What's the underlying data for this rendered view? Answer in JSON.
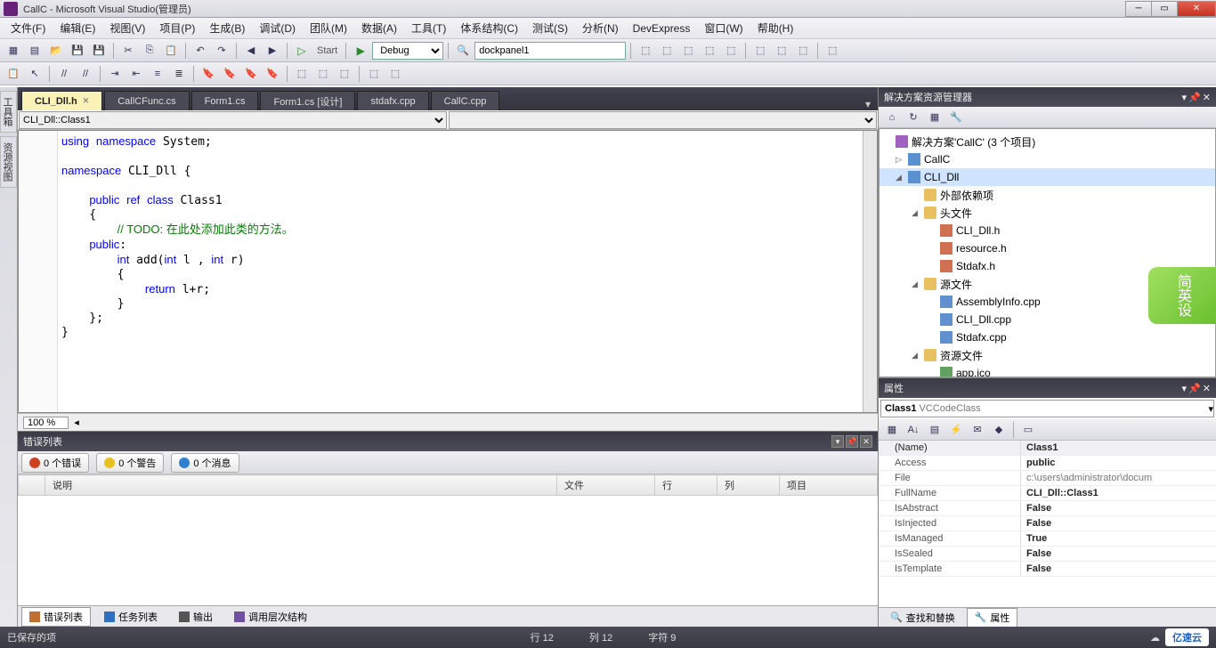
{
  "window": {
    "title": "CallC - Microsoft Visual Studio(管理员)"
  },
  "menu": [
    "文件(F)",
    "编辑(E)",
    "视图(V)",
    "项目(P)",
    "生成(B)",
    "调试(D)",
    "团队(M)",
    "数据(A)",
    "工具(T)",
    "体系结构(C)",
    "测试(S)",
    "分析(N)",
    "DevExpress",
    "窗口(W)",
    "帮助(H)"
  ],
  "toolbar1": {
    "start": "Start",
    "config": "Debug",
    "find": "dockpanel1"
  },
  "tabs": [
    {
      "label": "CLI_Dll.h",
      "active": true
    },
    {
      "label": "CallCFunc.cs"
    },
    {
      "label": "Form1.cs"
    },
    {
      "label": "Form1.cs [设计]"
    },
    {
      "label": "stdafx.cpp"
    },
    {
      "label": "CallC.cpp"
    }
  ],
  "navbar": {
    "scope": "CLI_Dll::Class1",
    "member": ""
  },
  "code": {
    "l1": "using namespace System;",
    "l2": "namespace CLI_Dll {",
    "l3": "    public ref class Class1",
    "l4": "    {",
    "l5": "        // TODO: 在此处添加此类的方法。",
    "l6": "    public:",
    "l7": "        int add(int l , int r)",
    "l8": "        {",
    "l9": "            return l+r;",
    "l10": "        }",
    "l11": "    };",
    "l12": "}"
  },
  "zoom": "100 %",
  "errorList": {
    "title": "错误列表",
    "errors": "0 个错误",
    "warnings": "0 个警告",
    "messages": "0 个消息",
    "cols": {
      "desc": "说明",
      "file": "文件",
      "line": "行",
      "col": "列",
      "proj": "项目"
    }
  },
  "bottomTabs": {
    "t1": "错误列表",
    "t2": "任务列表",
    "t3": "输出",
    "t4": "调用层次结构"
  },
  "solution": {
    "title": "解决方案资源管理器",
    "root": "解决方案'CallC' (3 个项目)",
    "items": [
      "CallC",
      "CLI_Dll",
      "外部依赖项",
      "头文件",
      "CLI_Dll.h",
      "resource.h",
      "Stdafx.h",
      "源文件",
      "AssemblyInfo.cpp",
      "CLI_Dll.cpp",
      "Stdafx.cpp",
      "资源文件",
      "app.ico"
    ]
  },
  "props": {
    "title": "属性",
    "selector": "Class1 VCCodeClass",
    "rows": [
      {
        "k": "(Name)",
        "v": "Class1"
      },
      {
        "k": "Access",
        "v": "public"
      },
      {
        "k": "File",
        "v": "c:\\users\\administrator\\docum"
      },
      {
        "k": "FullName",
        "v": "CLI_Dll::Class1"
      },
      {
        "k": "IsAbstract",
        "v": "False"
      },
      {
        "k": "IsInjected",
        "v": "False"
      },
      {
        "k": "IsManaged",
        "v": "True"
      },
      {
        "k": "IsSealed",
        "v": "False"
      },
      {
        "k": "IsTemplate",
        "v": "False"
      }
    ]
  },
  "rightBottomTabs": {
    "t1": "查找和替换",
    "t2": "属性"
  },
  "status": {
    "saved": "已保存的项",
    "line": "行 12",
    "col": "列 12",
    "char": "字符 9",
    "brand": "亿速云"
  },
  "badge": "简英设"
}
